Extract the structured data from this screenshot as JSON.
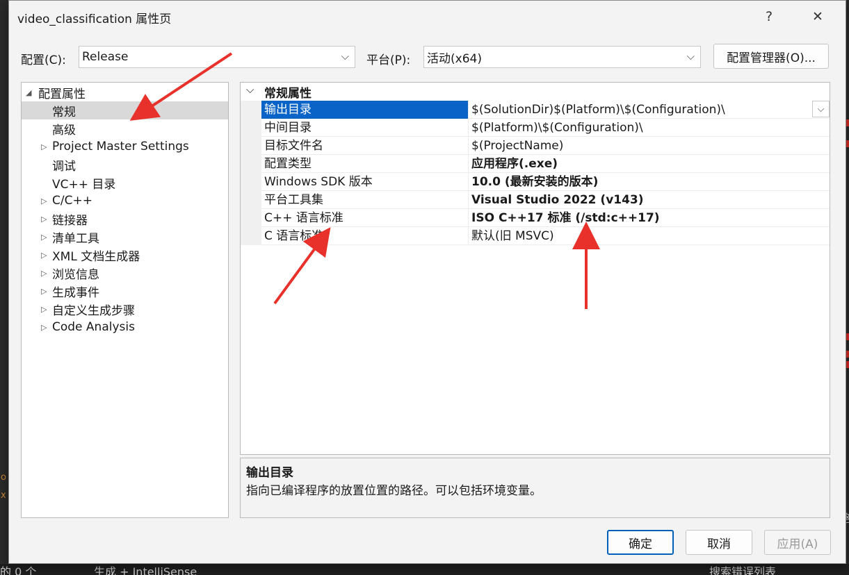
{
  "background": {
    "bottom_left_text": "的 0 个",
    "bottom_mid_text": "生成 + IntelliSense",
    "bottom_right_text": "搜索错误列表",
    "left_snippet_1": "o",
    "left_snippet_2": "x",
    "right_snippet": "格"
  },
  "dialog": {
    "title": "video_classification 属性页",
    "help_label": "?",
    "close_label": "✕"
  },
  "toolbar": {
    "config_label": "配置(C):",
    "config_value": "Release",
    "platform_label": "平台(P):",
    "platform_value": "活动(x64)",
    "config_manager_label": "配置管理器(O)..."
  },
  "tree": {
    "root": "配置属性",
    "items": [
      {
        "label": "常规",
        "expandable": false
      },
      {
        "label": "高级",
        "expandable": false
      },
      {
        "label": "Project Master Settings",
        "expandable": true
      },
      {
        "label": "调试",
        "expandable": false
      },
      {
        "label": "VC++ 目录",
        "expandable": false
      },
      {
        "label": "C/C++",
        "expandable": true
      },
      {
        "label": "链接器",
        "expandable": true
      },
      {
        "label": "清单工具",
        "expandable": true
      },
      {
        "label": "XML 文档生成器",
        "expandable": true
      },
      {
        "label": "浏览信息",
        "expandable": true
      },
      {
        "label": "生成事件",
        "expandable": true
      },
      {
        "label": "自定义生成步骤",
        "expandable": true
      },
      {
        "label": "Code Analysis",
        "expandable": true
      }
    ]
  },
  "grid": {
    "section": "常规属性",
    "rows": [
      {
        "name": "输出目录",
        "value": "$(SolutionDir)$(Platform)\\$(Configuration)\\"
      },
      {
        "name": "中间目录",
        "value": "$(Platform)\\$(Configuration)\\"
      },
      {
        "name": "目标文件名",
        "value": "$(ProjectName)"
      },
      {
        "name": "配置类型",
        "value": "应用程序(.exe)"
      },
      {
        "name": "Windows SDK 版本",
        "value": "10.0 (最新安装的版本)"
      },
      {
        "name": "平台工具集",
        "value": "Visual Studio 2022 (v143)"
      },
      {
        "name": "C++ 语言标准",
        "value": "ISO C++17 标准 (/std:c++17)"
      },
      {
        "name": "C 语言标准",
        "value": "默认(旧 MSVC)"
      }
    ]
  },
  "description": {
    "title": "输出目录",
    "text": "指向已编译程序的放置位置的路径。可以包括环境变量。"
  },
  "buttons": {
    "ok": "确定",
    "cancel": "取消",
    "apply": "应用(A)"
  },
  "colors": {
    "selection": "#0a64c8",
    "annotation_arrow": "#e8312a"
  }
}
